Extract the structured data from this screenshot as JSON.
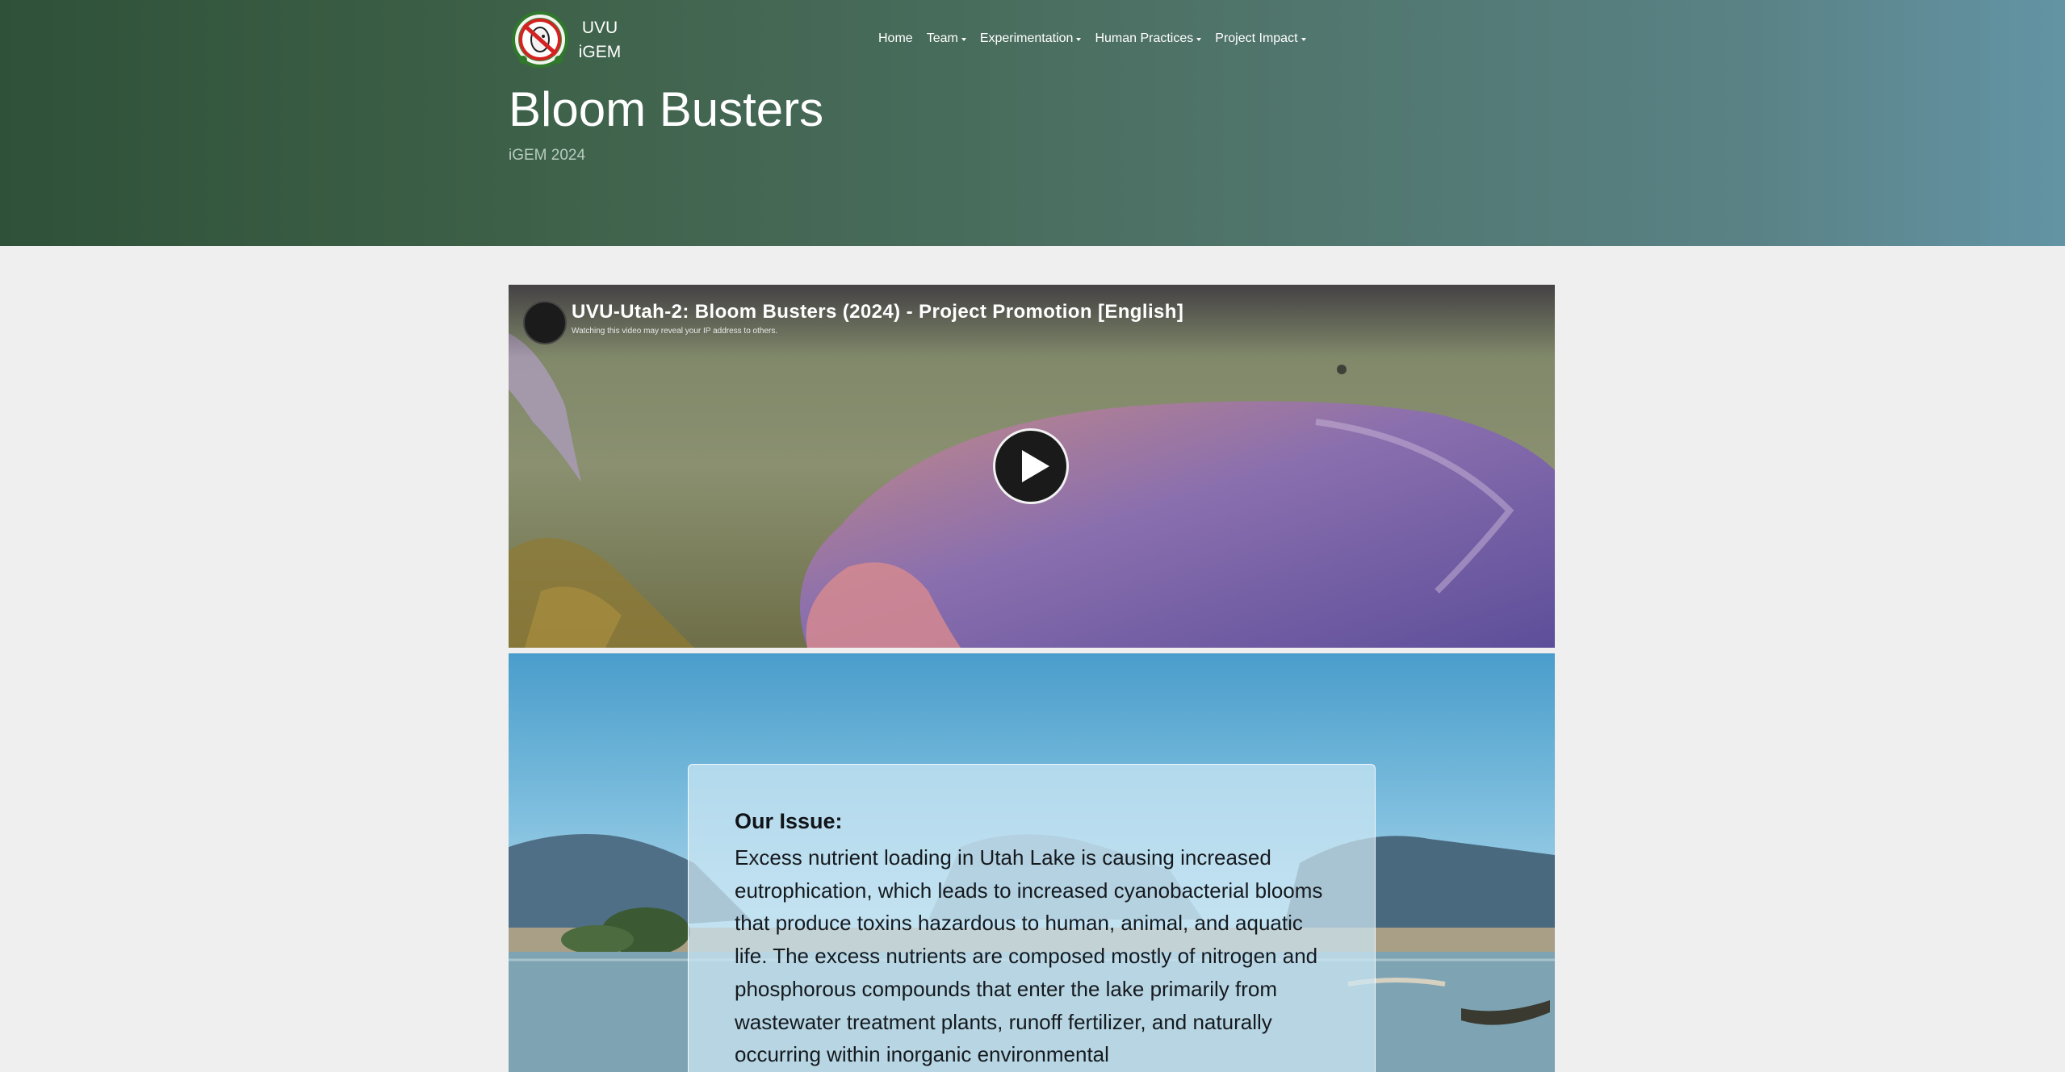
{
  "header": {
    "brand_line1": "UVU",
    "brand_line2": "iGEM",
    "title": "Bloom Busters",
    "subtitle": "iGEM 2024",
    "logo_icon": "ghostbusters-style-logo-icon"
  },
  "nav": {
    "items": [
      {
        "label": "Home",
        "dropdown": false
      },
      {
        "label": "Team",
        "dropdown": true
      },
      {
        "label": "Experimentation",
        "dropdown": true
      },
      {
        "label": "Human Practices",
        "dropdown": true
      },
      {
        "label": "Project Impact",
        "dropdown": true
      }
    ]
  },
  "video": {
    "title": "UVU-Utah-2: Bloom Busters (2024) - Project Promotion [English]",
    "note": "Watching this video may reveal your IP address to others.",
    "play_icon": "play-icon"
  },
  "issue": {
    "heading": "Our Issue:",
    "text": "Excess nutrient loading in Utah Lake is causing increased eutrophication, which leads to increased cyanobacterial blooms that produce toxins hazardous to human, animal, and aquatic life. The excess nutrients are composed mostly of nitrogen and phosphorous compounds that enter the lake primarily from wastewater treatment plants, runoff fertilizer, and naturally occurring within inorganic environmental"
  },
  "colors": {
    "header_start": "#2f5139",
    "header_end": "#6394a5",
    "page_bg": "#efefef"
  }
}
